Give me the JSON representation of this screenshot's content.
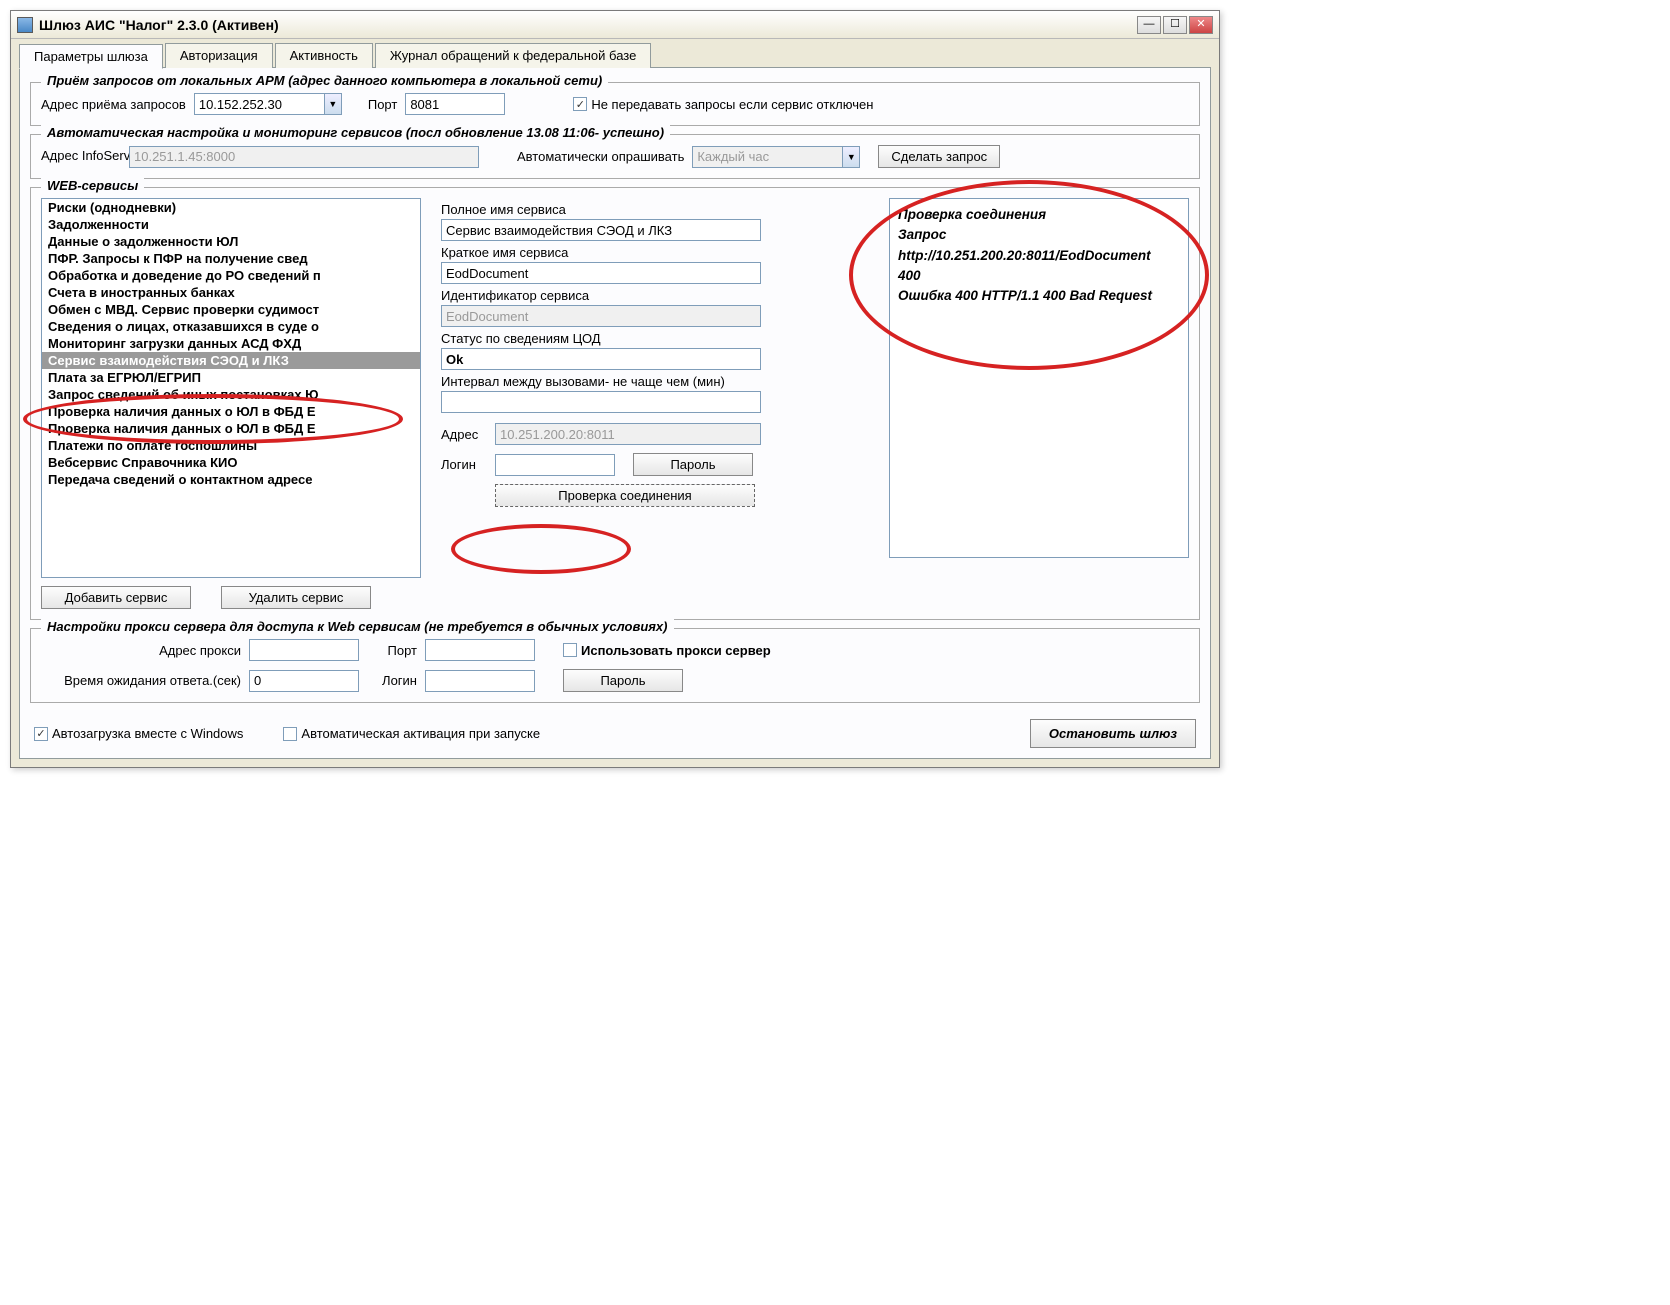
{
  "window": {
    "title": "Шлюз АИС \"Налог\" 2.3.0 (Активен)"
  },
  "tabs": {
    "params": "Параметры шлюза",
    "auth": "Авторизация",
    "activity": "Активность",
    "journal": "Журнал обращений к федеральной базе"
  },
  "section_local": {
    "legend": "Приём запросов от локальных АРМ (адрес данного компьютера в локальной сети)",
    "addr_label": "Адрес  приёма запросов",
    "addr_value": "10.152.252.30",
    "port_label": "Порт",
    "port_value": "8081",
    "no_forward_label": "Не передавать запросы если сервис отключен"
  },
  "section_auto": {
    "legend": "Автоматическая настройка и мониторинг сервисов (посл обновление  13.08 11:06- успешно)",
    "addr_label": "Адрес InfoService",
    "addr_value": "10.251.1.45:8000",
    "poll_label": "Автоматически опрашивать",
    "poll_value": "Каждый час",
    "request_btn": "Сделать запрос"
  },
  "section_web": {
    "legend": "WEB-сервисы",
    "list": [
      "Риски (однодневки)",
      "Задолженности",
      "Данные о задолженности ЮЛ",
      "ПФР. Запросы к ПФР на получение свед",
      "Обработка и доведение до РО сведений п",
      "Счета в иностранных банках",
      "Обмен с МВД. Сервис проверки судимост",
      "Сведения о лицах, отказавшихся в суде о",
      "Мониторинг загрузки данных АСД ФХД",
      "Сервис взаимодействия СЭОД и ЛКЗ",
      "Плата за ЕГРЮЛ/ЕГРИП",
      "Запрос сведений об иных постановках Ю",
      "Проверка наличия данных о ЮЛ в ФБД Е",
      "Проверка наличия данных о ЮЛ в ФБД Е",
      "Платежи по оплате госпошлины",
      "Вебсервис Справочника КИО",
      "Передача сведений о контактном адресе"
    ],
    "selected_index": 9,
    "add_btn": "Добавить сервис",
    "del_btn": "Удалить сервис",
    "full_name_label": "Полное имя сервиса",
    "full_name_value": "Сервис взаимодействия СЭОД и ЛКЗ",
    "short_name_label": "Краткое имя сервиса",
    "short_name_value": "EodDocument",
    "id_label": "Идентификатор сервиса",
    "id_value": "EodDocument",
    "status_label": "Статус по сведениям ЦОД",
    "status_value": "Ok",
    "interval_label": "Интервал между вызовами- не чаще чем (мин)",
    "interval_value": "",
    "addr_label": "Адрес",
    "addr_value": "10.251.200.20:8011",
    "login_label": "Логин",
    "login_value": "",
    "password_btn": "Пароль",
    "check_btn": "Проверка соединения",
    "result_text": "Проверка соединения\nЗапрос\nhttp://10.251.200.20:8011/EodDocument\n400\nОшибка 400 HTTP/1.1 400 Bad Request"
  },
  "section_proxy": {
    "legend": "Настройки прокси сервера для доступа к Web сервисам (не требуется в обычных условиях)",
    "addr_label": "Адрес прокси",
    "port_label": "Порт",
    "use_proxy_label": "Использовать прокси сервер",
    "timeout_label": "Время ожидания ответа.(сек)",
    "timeout_value": "0",
    "login_label": "Логин",
    "password_btn": "Пароль"
  },
  "footer": {
    "autoload_label": "Автозагрузка вместе с Windows",
    "autoactivate_label": "Автоматическая активация при запуске",
    "stop_btn": "Остановить шлюз"
  }
}
